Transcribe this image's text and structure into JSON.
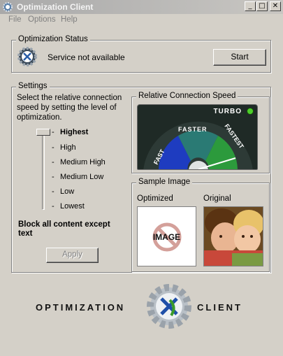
{
  "window": {
    "title": "Optimization Client"
  },
  "titlebar_buttons": {
    "minimize": "_",
    "maximize": "□",
    "close": "✕"
  },
  "menu": [
    "File",
    "Options",
    "Help"
  ],
  "status": {
    "group_title": "Optimization Status",
    "message": "Service not available",
    "start_label": "Start"
  },
  "settings": {
    "group_title": "Settings",
    "description": "Select the relative connection speed by setting the level of optimization.",
    "levels": [
      "Highest",
      "High",
      "Medium High",
      "Medium Low",
      "Low",
      "Lowest"
    ],
    "selected_level": "Highest",
    "block_text": "Block all content except text",
    "apply_label": "Apply"
  },
  "speed": {
    "group_title": "Relative Connection Speed",
    "turbo_label": "TURBO",
    "gauge_labels": [
      "FAST",
      "FASTER",
      "FASTEST"
    ],
    "turbo_led_color": "#4ccf2a"
  },
  "sample": {
    "group_title": "Sample Image",
    "optimized_label": "Optimized",
    "original_label": "Original",
    "placeholder_text": "IMAGE"
  },
  "brand": {
    "left_word": "OPTIMIZATION",
    "right_word": "CLIENT"
  }
}
